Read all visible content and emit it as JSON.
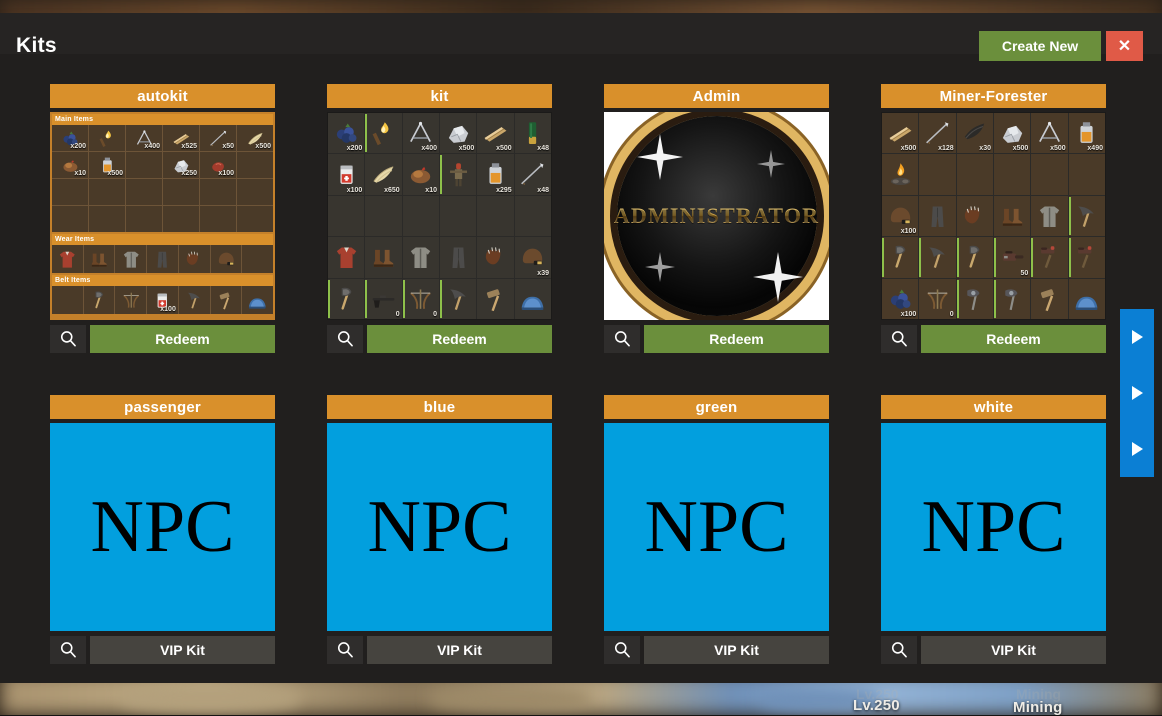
{
  "window": {
    "title": "Kits",
    "create_new_label": "Create New",
    "close_label": "✕"
  },
  "hud": {
    "level": "Lv.250",
    "activity": "Mining",
    "level_faint": "Lv.250",
    "activity_faint": "Mining"
  },
  "side_nav": {
    "arrows": [
      "play-arrow-1",
      "play-arrow-2",
      "play-arrow-3"
    ]
  },
  "icons": {
    "search": "magnifier-icon",
    "arrow": "play-arrow-icon"
  },
  "colors": {
    "header_orange": "#d9902b",
    "redeem_green": "#6b8f3c",
    "close_red": "#e05a47",
    "vip_gray": "#46443f",
    "panel_dark": "#211f1e",
    "titlebar": "#262423",
    "npc_blue": "#029fde",
    "side_nav_blue": "#0b7fd4"
  },
  "kits": [
    {
      "name": "autokit",
      "preview": "inventory-sectioned",
      "action_label": "Redeem",
      "action_type": "redeem",
      "sections": [
        {
          "label": "Main Items",
          "cols": 6,
          "rows": 4,
          "items": [
            {
              "icon": "berries",
              "qty": "x200"
            },
            {
              "icon": "torch",
              "qty": ""
            },
            {
              "icon": "rope-tool",
              "qty": "x400"
            },
            {
              "icon": "wood-plank",
              "qty": "x525"
            },
            {
              "icon": "arrow",
              "qty": "x50"
            },
            {
              "icon": "feathers",
              "qty": "x500"
            },
            {
              "icon": "cooked-meat",
              "qty": "x10"
            },
            {
              "icon": "low-grade-fuel",
              "qty": "x500"
            },
            {
              "icon": "",
              "qty": ""
            },
            {
              "icon": "stone",
              "qty": "x250"
            },
            {
              "icon": "raw-meat",
              "qty": "x100"
            },
            {
              "icon": "",
              "qty": ""
            }
          ]
        },
        {
          "label": "Wear Items",
          "cols": 7,
          "rows": 1,
          "items": [
            {
              "icon": "hoodie",
              "qty": ""
            },
            {
              "icon": "boots",
              "qty": ""
            },
            {
              "icon": "jacket",
              "qty": ""
            },
            {
              "icon": "pants",
              "qty": ""
            },
            {
              "icon": "gloves",
              "qty": ""
            },
            {
              "icon": "helmet",
              "qty": ""
            },
            {
              "icon": "",
              "qty": ""
            }
          ]
        },
        {
          "label": "Belt Items",
          "cols": 7,
          "rows": 1,
          "items": [
            {
              "icon": "",
              "qty": ""
            },
            {
              "icon": "hatchet",
              "qty": ""
            },
            {
              "icon": "crossbow",
              "qty": ""
            },
            {
              "icon": "medkit",
              "qty": "x100"
            },
            {
              "icon": "pickaxe",
              "qty": ""
            },
            {
              "icon": "hammer",
              "qty": ""
            },
            {
              "icon": "helmet-blue",
              "qty": ""
            }
          ]
        }
      ]
    },
    {
      "name": "kit",
      "preview": "inventory-grid",
      "action_label": "Redeem",
      "action_type": "redeem",
      "grid": {
        "cols": 6,
        "rows": 5,
        "items": [
          {
            "icon": "berries",
            "qty": "x200",
            "cond": false
          },
          {
            "icon": "torch",
            "qty": "",
            "cond": true
          },
          {
            "icon": "rope-tool",
            "qty": "x400",
            "cond": false
          },
          {
            "icon": "stone",
            "qty": "x500",
            "cond": false
          },
          {
            "icon": "wood-plank",
            "qty": "x500",
            "cond": false
          },
          {
            "icon": "shotgun-shell",
            "qty": "x48",
            "cond": false
          },
          {
            "icon": "medkit",
            "qty": "x100",
            "cond": false
          },
          {
            "icon": "feathers",
            "qty": "x650",
            "cond": false
          },
          {
            "icon": "cooked-meat",
            "qty": "x10",
            "cond": false
          },
          {
            "icon": "scarecrow",
            "qty": "",
            "cond": true
          },
          {
            "icon": "low-grade-fuel",
            "qty": "x295",
            "cond": false
          },
          {
            "icon": "arrow",
            "qty": "x48",
            "cond": false
          },
          {
            "icon": "",
            "qty": "",
            "cond": false
          },
          {
            "icon": "",
            "qty": "",
            "cond": false
          },
          {
            "icon": "",
            "qty": "",
            "cond": false
          },
          {
            "icon": "",
            "qty": "",
            "cond": false
          },
          {
            "icon": "",
            "qty": "",
            "cond": false
          },
          {
            "icon": "",
            "qty": "",
            "cond": false
          },
          {
            "icon": "hoodie",
            "qty": "",
            "cond": false
          },
          {
            "icon": "boots",
            "qty": "",
            "cond": false
          },
          {
            "icon": "jacket",
            "qty": "",
            "cond": false
          },
          {
            "icon": "pants",
            "qty": "",
            "cond": false
          },
          {
            "icon": "gloves",
            "qty": "",
            "cond": false
          },
          {
            "icon": "helmet",
            "qty": "x39",
            "cond": false
          },
          {
            "icon": "hatchet",
            "qty": "",
            "cond": true
          },
          {
            "icon": "rifle",
            "qty": "0",
            "cond": true
          },
          {
            "icon": "crossbow",
            "qty": "0",
            "cond": true
          },
          {
            "icon": "pickaxe",
            "qty": "",
            "cond": true
          },
          {
            "icon": "hammer",
            "qty": "",
            "cond": false
          },
          {
            "icon": "helmet-blue",
            "qty": "",
            "cond": false
          }
        ]
      }
    },
    {
      "name": "Admin",
      "preview": "admin-badge",
      "badge_text": "ADMINISTRATOR",
      "action_label": "Redeem",
      "action_type": "redeem"
    },
    {
      "name": "Miner-Forester",
      "preview": "inventory-grid",
      "action_label": "Redeem",
      "action_type": "redeem",
      "grid": {
        "cols": 6,
        "rows": 5,
        "items": [
          {
            "icon": "wood-plank",
            "qty": "x500",
            "cond": false
          },
          {
            "icon": "arrow",
            "qty": "x128",
            "cond": false
          },
          {
            "icon": "cloth",
            "qty": "x30",
            "cond": false
          },
          {
            "icon": "stone",
            "qty": "x500",
            "cond": false
          },
          {
            "icon": "rope-tool",
            "qty": "x500",
            "cond": false
          },
          {
            "icon": "low-grade-fuel",
            "qty": "x490",
            "cond": false
          },
          {
            "icon": "campfire",
            "qty": "",
            "cond": false
          },
          {
            "icon": "",
            "qty": "",
            "cond": false
          },
          {
            "icon": "",
            "qty": "",
            "cond": false
          },
          {
            "icon": "",
            "qty": "",
            "cond": false
          },
          {
            "icon": "",
            "qty": "",
            "cond": false
          },
          {
            "icon": "",
            "qty": "",
            "cond": false
          },
          {
            "icon": "helmet",
            "qty": "x100",
            "cond": false
          },
          {
            "icon": "pants",
            "qty": "",
            "cond": false
          },
          {
            "icon": "gloves",
            "qty": "",
            "cond": false
          },
          {
            "icon": "boots",
            "qty": "",
            "cond": false
          },
          {
            "icon": "jacket",
            "qty": "",
            "cond": false
          },
          {
            "icon": "pickaxe",
            "qty": "",
            "cond": true
          },
          {
            "icon": "hatchet",
            "qty": "",
            "cond": true
          },
          {
            "icon": "pickaxe",
            "qty": "",
            "cond": true
          },
          {
            "icon": "hatchet",
            "qty": "",
            "cond": true
          },
          {
            "icon": "chainsaw",
            "qty": "50",
            "cond": true
          },
          {
            "icon": "jackhammer",
            "qty": "",
            "cond": true
          },
          {
            "icon": "jackhammer",
            "qty": "",
            "cond": true
          },
          {
            "icon": "berries",
            "qty": "x100",
            "cond": false
          },
          {
            "icon": "crossbow",
            "qty": "0",
            "cond": false
          },
          {
            "icon": "salvaged-axe",
            "qty": "",
            "cond": true
          },
          {
            "icon": "salvaged-axe",
            "qty": "",
            "cond": true
          },
          {
            "icon": "hammer",
            "qty": "",
            "cond": false
          },
          {
            "icon": "helmet-blue",
            "qty": "",
            "cond": false
          }
        ]
      }
    },
    {
      "name": "passenger",
      "preview": "npc",
      "npc_text": "NPC",
      "action_label": "VIP Kit",
      "action_type": "vip"
    },
    {
      "name": "blue",
      "preview": "npc",
      "npc_text": "NPC",
      "action_label": "VIP Kit",
      "action_type": "vip"
    },
    {
      "name": "green",
      "preview": "npc",
      "npc_text": "NPC",
      "action_label": "VIP Kit",
      "action_type": "vip"
    },
    {
      "name": "white",
      "preview": "npc",
      "npc_text": "NPC",
      "action_label": "VIP Kit",
      "action_type": "vip"
    }
  ]
}
